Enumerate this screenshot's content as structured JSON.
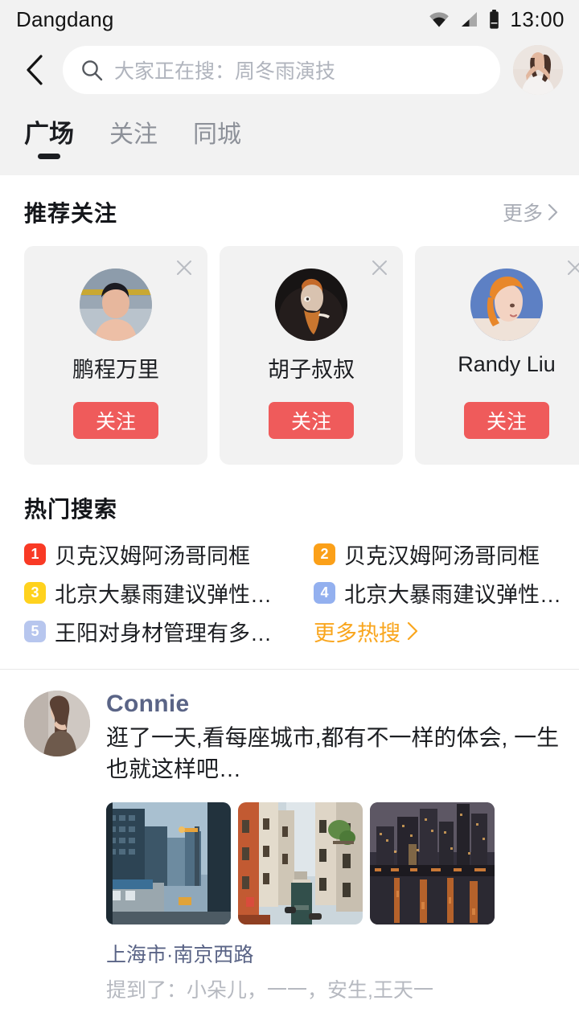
{
  "statusbar": {
    "app_title": "Dangdang",
    "time": "13:00",
    "icons": [
      "wifi-icon",
      "cellular-signal-icon",
      "battery-icon"
    ]
  },
  "header": {
    "back_icon": "chevron-left-icon",
    "search": {
      "icon": "search-icon",
      "placeholder": "大家正在搜：周冬雨演技",
      "value": ""
    },
    "profile_avatar": "user-avatar"
  },
  "tabs": [
    {
      "label": "广场",
      "active": true
    },
    {
      "label": "关注",
      "active": false
    },
    {
      "label": "同城",
      "active": false
    }
  ],
  "recommend": {
    "title": "推荐关注",
    "more_label": "更多",
    "more_icon": "chevron-right-icon",
    "close_icon": "close-icon",
    "cards": [
      {
        "name": "鹏程万里",
        "follow_label": "关注"
      },
      {
        "name": "胡子叔叔",
        "follow_label": "关注"
      },
      {
        "name": "Randy Liu",
        "follow_label": "关注"
      }
    ]
  },
  "hot_search": {
    "title": "热门搜索",
    "items": [
      {
        "rank": "1",
        "text": "贝克汉姆阿汤哥同框",
        "color": "#f93a25"
      },
      {
        "rank": "2",
        "text": "贝克汉姆阿汤哥同框",
        "color": "#fba019"
      },
      {
        "rank": "3",
        "text": "北京大暴雨建议弹性…",
        "color": "#ffd21e"
      },
      {
        "rank": "4",
        "text": "北京大暴雨建议弹性…",
        "color": "#93b0ef"
      },
      {
        "rank": "5",
        "text": "王阳对身材管理有多…",
        "color": "#b7c6ee"
      }
    ],
    "more_label": "更多热搜",
    "more_icon": "chevron-right-icon",
    "more_color": "#f9a61e"
  },
  "post": {
    "username": "Connie",
    "content": "逛了一天,看每座城市,都有不一样的体会, 一生也就这样吧…",
    "images": [
      "city-street-photo",
      "venice-canal-photo",
      "waterfront-skyline-photo"
    ],
    "location": "上海市·南京西路",
    "mentions": "提到了：小朵儿，一一，安生,王天一"
  },
  "colors": {
    "accent_red": "#ef5b5b",
    "accent_orange": "#f9a61e",
    "link_blue": "#5a6486",
    "header_bg": "#f2f2f2",
    "card_bg": "#f2f2f2"
  }
}
